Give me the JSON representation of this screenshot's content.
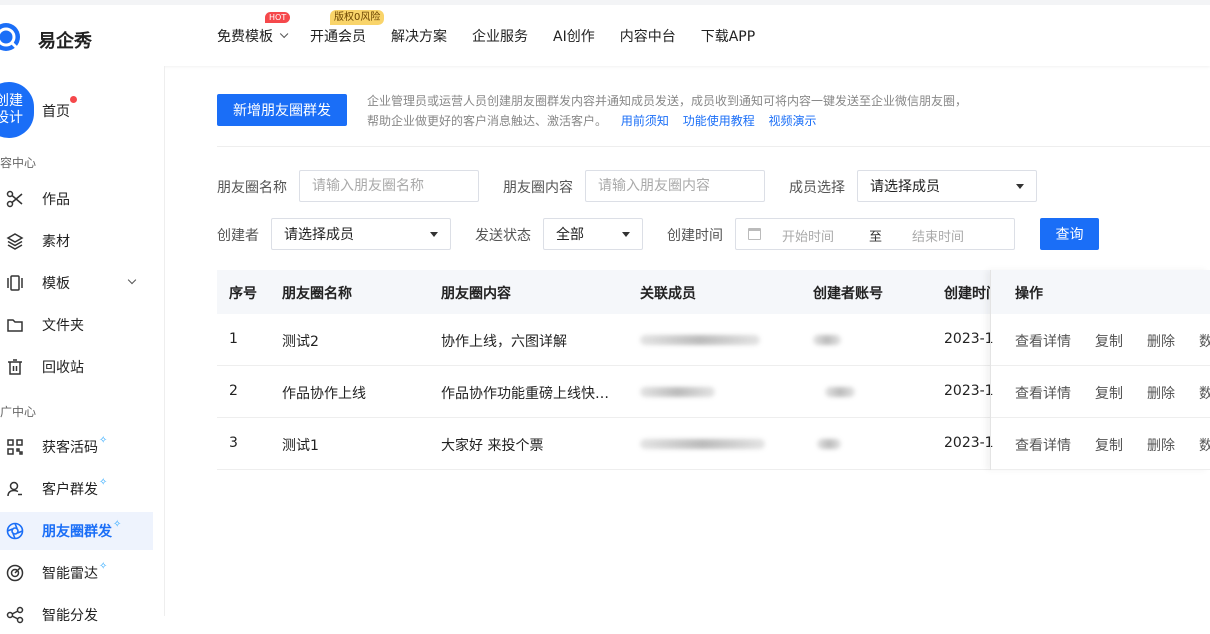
{
  "app": {
    "name": "易企秀"
  },
  "nav": {
    "items": [
      {
        "label": "免费模板",
        "badge": "HOT"
      },
      {
        "label": "开通会员",
        "badge": "版权0风险"
      },
      {
        "label": "解决方案"
      },
      {
        "label": "企业服务"
      },
      {
        "label": "AI创作"
      },
      {
        "label": "内容中台"
      },
      {
        "label": "下载APP"
      }
    ]
  },
  "sidebar": {
    "create_label": "创建设计",
    "create_line1": "创建",
    "create_line2": "设计",
    "home_label": "首页",
    "section1": "容中心",
    "section2": "广中心",
    "items": [
      {
        "label": "作品",
        "icon": "scissors-icon"
      },
      {
        "label": "素材",
        "icon": "layers-icon"
      },
      {
        "label": "模板",
        "icon": "template-icon"
      },
      {
        "label": "文件夹",
        "icon": "folder-icon"
      },
      {
        "label": "回收站",
        "icon": "trash-icon"
      },
      {
        "label": "获客活码",
        "icon": "qrcode-icon"
      },
      {
        "label": "客户群发",
        "icon": "user-icon"
      },
      {
        "label": "朋友圈群发",
        "icon": "moments-icon"
      },
      {
        "label": "智能雷达",
        "icon": "radar-icon"
      },
      {
        "label": "智能分发",
        "icon": "share-icon"
      }
    ]
  },
  "main": {
    "add_button": "新增朋友圈群发",
    "desc_line1": "企业管理员或运营人员创建朋友圈群发内容并通知成员发送，成员收到通知可将内容一键发送至企业微信朋友圈，",
    "desc_line2": "帮助企业做更好的客户消息触达、激活客户。",
    "links": [
      "用前须知",
      "功能使用教程",
      "视频演示"
    ]
  },
  "filters": {
    "name_label": "朋友圈名称",
    "name_placeholder": "请输入朋友圈名称",
    "content_label": "朋友圈内容",
    "content_placeholder": "请输入朋友圈内容",
    "member_label": "成员选择",
    "member_value": "请选择成员",
    "creator_label": "创建者",
    "creator_value": "请选择成员",
    "status_label": "发送状态",
    "status_value": "全部",
    "time_label": "创建时间",
    "start_placeholder": "开始时间",
    "to": "至",
    "end_placeholder": "结束时间",
    "query_button": "查询"
  },
  "table": {
    "headers": [
      "序号",
      "朋友圈名称",
      "朋友圈内容",
      "关联成员",
      "创建者账号",
      "创建时间",
      "操作"
    ],
    "rows": [
      {
        "no": "1",
        "name": "测试2",
        "content": "协作上线，六图详解",
        "created": "2023-1"
      },
      {
        "no": "2",
        "name": "作品协作上线",
        "content": "作品协作功能重磅上线快…",
        "created": "2023-1"
      },
      {
        "no": "3",
        "name": "测试1",
        "content": "大家好 来投个票",
        "created": "2023-1"
      }
    ],
    "actions": [
      "查看详情",
      "复制",
      "删除",
      "数"
    ]
  },
  "colors": {
    "accent": "#1a6ef7",
    "red_dot": "#f5484b"
  }
}
